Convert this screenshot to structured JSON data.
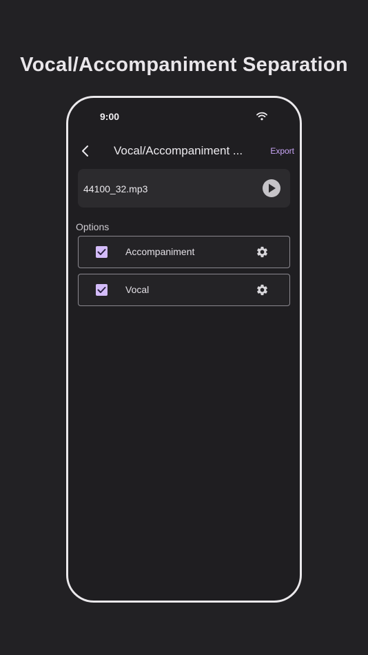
{
  "headline": "Vocal/Accompaniment Separation",
  "status_bar": {
    "time": "9:00"
  },
  "nav": {
    "title": "Vocal/Accompaniment ...",
    "export_label": "Export"
  },
  "file": {
    "name": "44100_32.mp3"
  },
  "options": {
    "label": "Options",
    "items": [
      {
        "label": "Accompaniment",
        "checked": true
      },
      {
        "label": "Vocal",
        "checked": true
      }
    ]
  },
  "colors": {
    "background": "#222124",
    "accent": "#c9a6f7",
    "checkbox": "#d4bcfa"
  }
}
